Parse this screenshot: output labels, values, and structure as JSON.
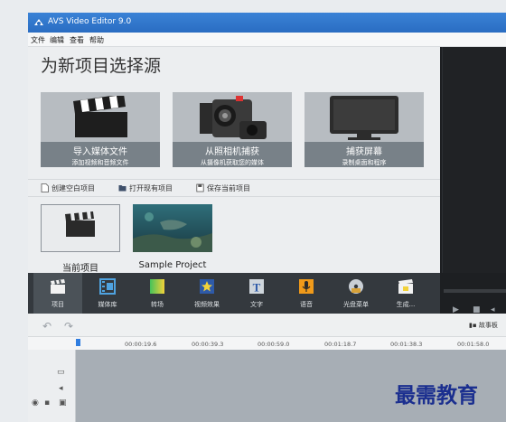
{
  "window": {
    "title": "AVS Video Editor 9.0"
  },
  "menu": [
    "文件",
    "编辑",
    "查看",
    "帮助"
  ],
  "source_panel": {
    "heading": "为新项目选择源",
    "tiles": [
      {
        "title": "导入媒体文件",
        "subtitle": "添加视频和音频文件"
      },
      {
        "title": "从照相机捕获",
        "subtitle": "从摄像机获取您的媒体"
      },
      {
        "title": "捕获屏幕",
        "subtitle": "录制桌面和程序"
      }
    ],
    "actions": [
      "创建空白项目",
      "打开现有项目",
      "保存当前项目"
    ],
    "projects": [
      {
        "label": "当前项目"
      },
      {
        "label": "Sample Project"
      }
    ]
  },
  "toolbar": {
    "items": [
      {
        "label": "项目",
        "icon": "clapper-icon",
        "active": true
      },
      {
        "label": "媒体库",
        "icon": "film-icon"
      },
      {
        "label": "转场",
        "icon": "transition-icon"
      },
      {
        "label": "视频效果",
        "icon": "star-effect-icon"
      },
      {
        "label": "文字",
        "icon": "text-icon"
      },
      {
        "label": "语音",
        "icon": "microphone-icon"
      },
      {
        "label": "光盘菜单",
        "icon": "disc-menu-icon"
      },
      {
        "label": "生成...",
        "icon": "produce-icon"
      }
    ]
  },
  "timeline": {
    "story_label": "故事板",
    "ticks": [
      "00:00:19.6",
      "00:00:39.3",
      "00:00:59.0",
      "00:01:18.7",
      "00:01:38.3",
      "00:01:58.0"
    ]
  },
  "watermark": "最需教育",
  "colors": {
    "titlebar": "#2f78cf",
    "toolbar": "#34393e",
    "timeline_lane": "#a7aeb5",
    "watermark": "#1b2f8f"
  }
}
